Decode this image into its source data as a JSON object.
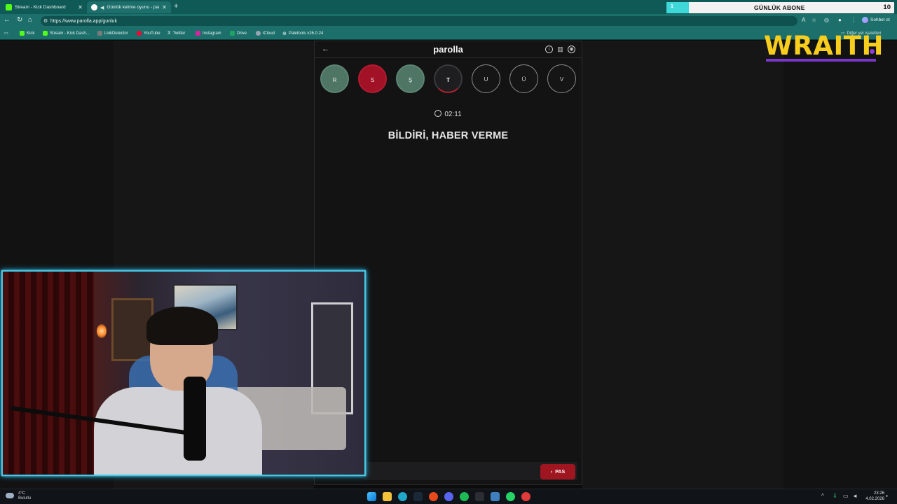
{
  "browser": {
    "tabs": [
      {
        "title": "Stream - Kick Dashboard",
        "fav_color": "#53fc18"
      },
      {
        "title": "Günlük kelime oyunu - parolla",
        "fav_color": "#ffffff"
      }
    ],
    "url": "https://www.parolla.app/gunluk",
    "chat_button": "Sohbet et",
    "other_users": "Diğer yer işaretleri",
    "bookmarks": [
      {
        "label": "Kick",
        "color": "#53fc18"
      },
      {
        "label": "Stream - Kick Dash...",
        "color": "#53fc18"
      },
      {
        "label": "LinkDetector",
        "color": "#7a7a7a"
      },
      {
        "label": "YouTube",
        "color": "#ff0033"
      },
      {
        "label": "Twitter",
        "color": "#222222"
      },
      {
        "label": "Instagram",
        "color": "#d6249f"
      },
      {
        "label": "Drive",
        "color": "#1fa463"
      },
      {
        "label": "iCloud",
        "color": "#9aa4b2"
      },
      {
        "label": "Paletools v26.0.24",
        "color": "#cfd3da"
      }
    ]
  },
  "overlay": {
    "sub_progress_value": "1",
    "sub_label": "GÜNLÜK ABONE",
    "sub_goal": "10",
    "logo": "WRAITH"
  },
  "app": {
    "title": "parolla",
    "letters": [
      {
        "char": "R",
        "state": "green"
      },
      {
        "char": "S",
        "state": "red"
      },
      {
        "char": "Ş",
        "state": "green"
      },
      {
        "char": "T",
        "state": "active"
      },
      {
        "char": "U",
        "state": "empty"
      },
      {
        "char": "Ü",
        "state": "empty"
      },
      {
        "char": "V",
        "state": "empty"
      }
    ],
    "timer": "02:11",
    "question": "BİLDİRİ, HABER VERME",
    "pass_button": "PAS"
  },
  "taskbar": {
    "weather_temp": "4°C",
    "weather_desc": "Bulutlu",
    "time": "23:26",
    "date": "4.02.2026"
  }
}
